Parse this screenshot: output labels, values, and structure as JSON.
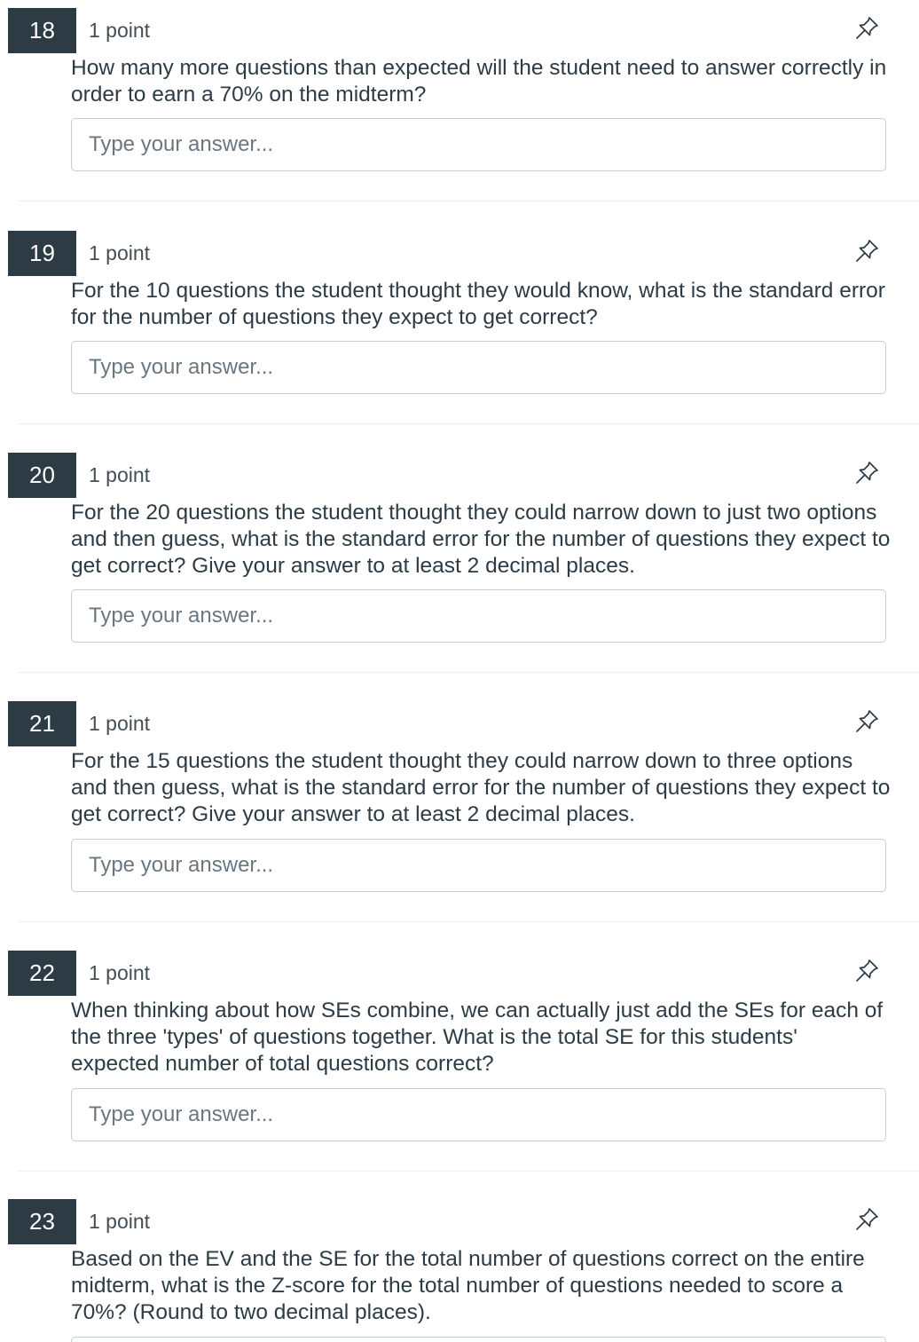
{
  "questions": [
    {
      "number": "18",
      "points": "1 point",
      "text": "How many more questions than expected will the student need to answer correctly in order to earn a 70% on the midterm?",
      "placeholder": "Type your answer..."
    },
    {
      "number": "19",
      "points": "1 point",
      "text": "For the 10 questions the student thought they would know, what is the standard error for the number of questions they expect to get correct?",
      "placeholder": "Type your answer..."
    },
    {
      "number": "20",
      "points": "1 point",
      "text": "For the 20 questions the student thought they could narrow down to just two options and then guess, what is the standard error for the number of questions they expect to get correct? Give your answer to at least 2 decimal places.",
      "placeholder": "Type your answer..."
    },
    {
      "number": "21",
      "points": "1 point",
      "text": "For the 15 questions the student thought they could narrow down to three options and then guess, what is the standard error for the number of questions they expect to get correct? Give your answer to at least 2 decimal places.",
      "placeholder": "Type your answer..."
    },
    {
      "number": "22",
      "points": "1 point",
      "text": "When thinking about how SEs combine, we can actually just add the SEs for each of the three 'types' of questions together. What is the total SE for this students' expected number of total questions correct?",
      "placeholder": "Type your answer..."
    },
    {
      "number": "23",
      "points": "1 point",
      "text": "Based on the EV and the SE for the total number of questions correct on the entire midterm, what is the Z-score for the total number of questions needed to score a 70%? (Round to two decimal places).",
      "placeholder": "Type your answer..."
    }
  ]
}
